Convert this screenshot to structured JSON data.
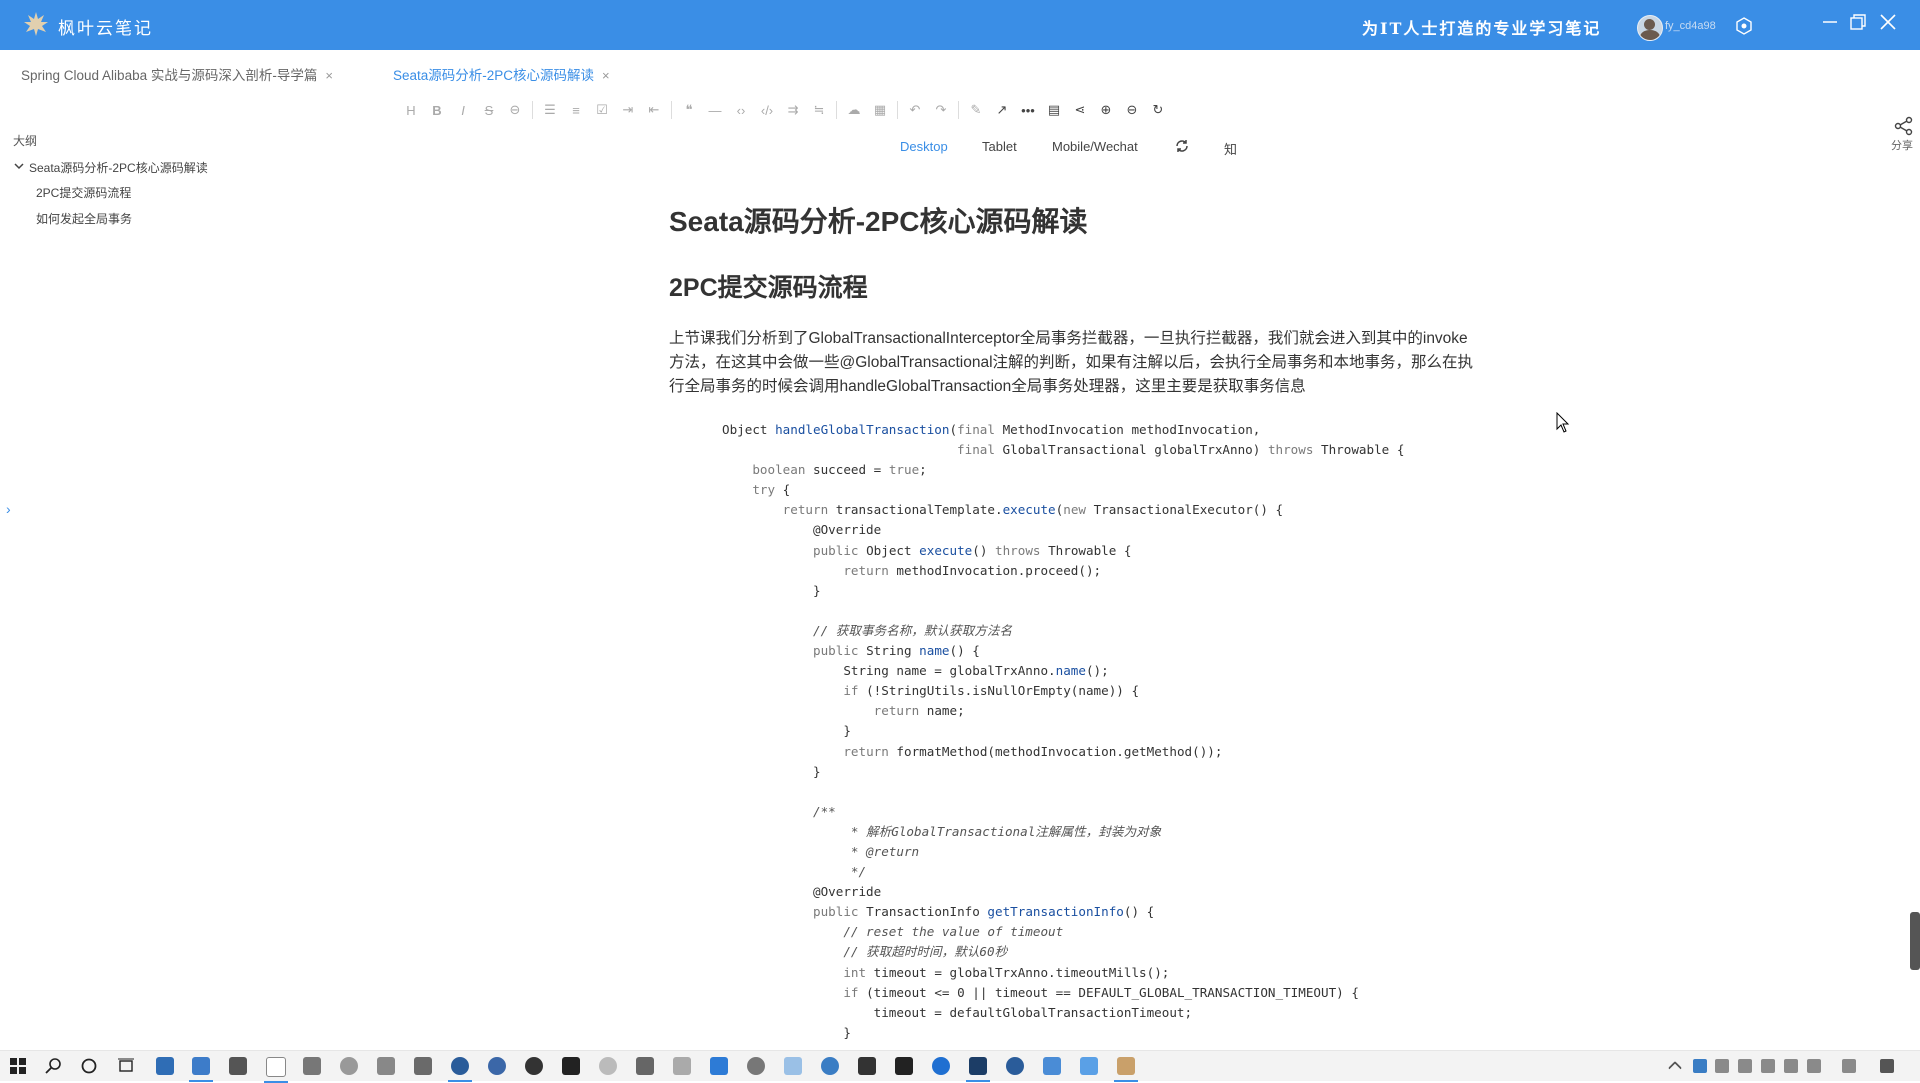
{
  "app": {
    "name": "枫叶云笔记",
    "slogan": "为IT人士打造的专业学习笔记",
    "username": "fy_cd4a98"
  },
  "tabs": [
    {
      "label": "Spring Cloud Alibaba 实战与源码深入剖析-导学篇",
      "close": "×"
    },
    {
      "label": "Seata源码分析-2PC核心源码解读",
      "close": "×"
    }
  ],
  "toolbar": {
    "icons": [
      "heading-icon",
      "bold-icon",
      "italic-icon",
      "strikethrough-icon",
      "link-icon",
      "unordered-list-icon",
      "ordered-list-icon",
      "checklist-icon",
      "indent-icon",
      "outdent-icon",
      "quote-icon",
      "hr-icon",
      "inline-code-icon",
      "code-block-icon",
      "insert-row-icon",
      "insert-after-icon",
      "upload-icon",
      "table-icon",
      "undo-icon",
      "redo-icon",
      "edit-icon",
      "export-icon",
      "more-icon",
      "outline-icon",
      "mindmap-icon",
      "zoom-in-icon",
      "zoom-out-icon",
      "refresh-icon"
    ]
  },
  "modes": {
    "desktop": "Desktop",
    "tablet": "Tablet",
    "mobile": "Mobile/Wechat",
    "zhihu": "知"
  },
  "share": {
    "label": "分享"
  },
  "outline": {
    "title": "大纲",
    "items": [
      "Seata源码分析-2PC核心源码解读",
      "2PC提交源码流程",
      "如何发起全局事务"
    ]
  },
  "document": {
    "h1": "Seata源码分析-2PC核心源码解读",
    "h2": "2PC提交源码流程",
    "paragraph": "上节课我们分析到了GlobalTransactionalInterceptor全局事务拦截器，一旦执行拦截器，我们就会进入到其中的invoke方法，在这其中会做一些@GlobalTransactional注解的判断，如果有注解以后，会执行全局事务和本地事务，那么在执行全局事务的时候会调用handleGlobalTransaction全局事务处理器，这里主要是获取事务信息"
  },
  "code_lines": [
    "Object handleGlobalTransaction(final MethodInvocation methodInvocation,",
    "                               final GlobalTransactional globalTrxAnno) throws Throwable {",
    "    boolean succeed = true;",
    "    try {",
    "        return transactionalTemplate.execute(new TransactionalExecutor() {",
    "            @Override",
    "            public Object execute() throws Throwable {",
    "                return methodInvocation.proceed();",
    "            }",
    "",
    "            // 获取事务名称，默认获取方法名",
    "            public String name() {",
    "                String name = globalTrxAnno.name();",
    "                if (!StringUtils.isNullOrEmpty(name)) {",
    "                    return name;",
    "                }",
    "                return formatMethod(methodInvocation.getMethod());",
    "            }",
    "",
    "            /**",
    "                 * 解析GlobalTransactional注解属性，封装为对象",
    "                 * @return",
    "                 */",
    "            @Override",
    "            public TransactionInfo getTransactionInfo() {",
    "                // reset the value of timeout",
    "                // 获取超时时间，默认60秒",
    "                int timeout = globalTrxAnno.timeoutMills();",
    "                if (timeout <= 0 || timeout == DEFAULT_GLOBAL_TRANSACTION_TIMEOUT) {",
    "                    timeout = defaultGlobalTransactionTimeout;",
    "                }"
  ],
  "colors": {
    "brand": "#3a8ee6",
    "text": "#333333",
    "muted": "#999999"
  }
}
